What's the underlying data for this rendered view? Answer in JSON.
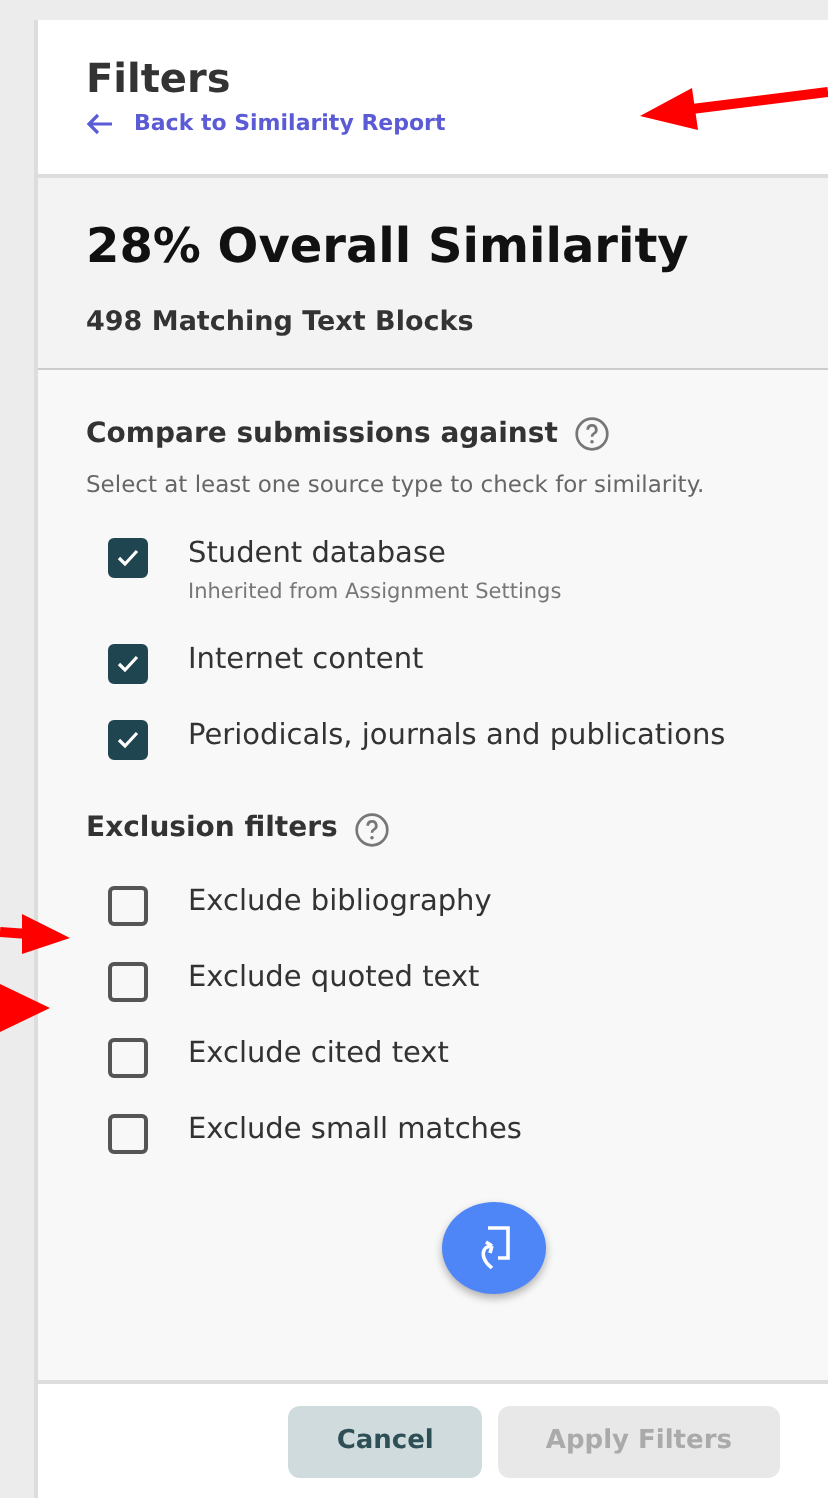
{
  "header": {
    "title": "Filters",
    "back_link": "Back to Similarity Report"
  },
  "summary": {
    "headline": "28% Overall Similarity",
    "subline": "498 Matching Text Blocks"
  },
  "sections": [
    {
      "title": "Compare submissions against",
      "description": "Select at least one source type to check for similarity.",
      "options": [
        {
          "label": "Student database",
          "note": "Inherited from Assignment Settings",
          "checked": true
        },
        {
          "label": "Internet content",
          "checked": true
        },
        {
          "label": "Periodicals, journals and publications",
          "checked": true
        }
      ]
    },
    {
      "title": "Exclusion filters",
      "options": [
        {
          "label": "Exclude bibliography",
          "checked": false
        },
        {
          "label": "Exclude quoted text",
          "checked": false
        },
        {
          "label": "Exclude cited text",
          "checked": false
        },
        {
          "label": "Exclude small matches",
          "checked": false
        }
      ]
    }
  ],
  "footer": {
    "buttons": [
      {
        "label": "Cancel",
        "disabled": false
      },
      {
        "label": "Apply Filters",
        "disabled": true
      }
    ]
  }
}
